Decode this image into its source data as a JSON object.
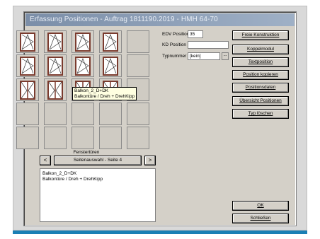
{
  "window": {
    "title": "Erfassung Positionen - Auftrag 1811190.2019 - HMH 64-70"
  },
  "grid": {
    "window_cells": [
      {
        "type": "window-single"
      },
      {
        "type": "window-single"
      },
      {
        "type": "window-single"
      },
      {
        "type": "window-single"
      },
      {
        "type": "window-single"
      },
      {
        "type": "window-single"
      },
      {
        "type": "window-single"
      },
      {
        "type": "window-single"
      },
      {
        "type": "door-double"
      },
      {
        "type": "door-double"
      },
      {
        "type": "door-double"
      },
      {
        "type": "door-double"
      }
    ],
    "caption": "Fenstertüren"
  },
  "tooltip": {
    "line1": "Balkon_2_D+DK",
    "line2": "Balkontüre / Dreh + DrehKipp"
  },
  "navigation": {
    "prev_icon": "<",
    "next_icon": ">",
    "page_label": "Seitenauswahl - Seite 4"
  },
  "info": {
    "line1": "Balkon_2_D+DK",
    "line2": "Balkontüre / Dreh + DrehKipp"
  },
  "form": {
    "edv_label": "EDV Position",
    "edv_value": "35",
    "kd_label": "KD Position",
    "kd_value": "",
    "typ_label": "Typnummer",
    "typ_value": "[kein]",
    "typ_button": "..."
  },
  "buttons": {
    "freie": "Freie Konstruktion",
    "koppel": "Koppelmodul",
    "text": "Textposition",
    "kopieren": "Position kopieren",
    "daten": "Positionsdaten",
    "uebersicht": "Übersicht Positionen",
    "typ_loeschen": "Typ löschen",
    "ok": "OK",
    "schliessen": "Schließen"
  },
  "colors": {
    "frame_brown": "#7a3b2e",
    "title_bar": "#8fa1b9",
    "accent_bar": "#1a7fb4"
  }
}
